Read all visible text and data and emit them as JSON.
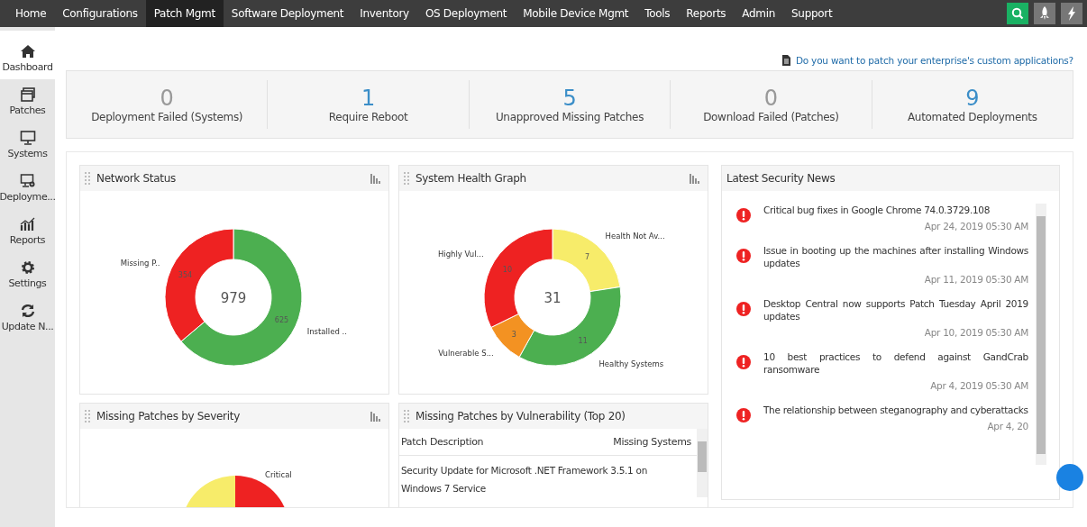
{
  "top_nav": {
    "items": [
      {
        "label": "Home",
        "selected": false
      },
      {
        "label": "Configurations",
        "selected": false
      },
      {
        "label": "Patch Mgmt",
        "selected": true
      },
      {
        "label": "Software Deployment",
        "selected": false
      },
      {
        "label": "Inventory",
        "selected": false
      },
      {
        "label": "OS Deployment",
        "selected": false
      },
      {
        "label": "Mobile Device Mgmt",
        "selected": false
      },
      {
        "label": "Tools",
        "selected": false
      },
      {
        "label": "Reports",
        "selected": false
      },
      {
        "label": "Admin",
        "selected": false
      },
      {
        "label": "Support",
        "selected": false
      }
    ]
  },
  "sidebar": {
    "items": [
      {
        "label": "Dashboard",
        "kind": "home",
        "selected": true
      },
      {
        "label": "Patches",
        "kind": "windows",
        "selected": false
      },
      {
        "label": "Systems",
        "kind": "monitor",
        "selected": false
      },
      {
        "label": "Deployme...",
        "kind": "deploy",
        "selected": false
      },
      {
        "label": "Reports",
        "kind": "chart",
        "selected": false
      },
      {
        "label": "Settings",
        "kind": "gear",
        "selected": false
      },
      {
        "label": "Update N...",
        "kind": "sync",
        "selected": false
      }
    ]
  },
  "custom_apps_link": "Do you want to patch your enterprise's custom applications?",
  "stats": [
    {
      "value": "0",
      "label": "Deployment Failed (Systems)",
      "highlighted": false
    },
    {
      "value": "1",
      "label": "Require Reboot",
      "highlighted": true
    },
    {
      "value": "5",
      "label": "Unapproved Missing Patches",
      "highlighted": true
    },
    {
      "value": "0",
      "label": "Download Failed (Patches)",
      "highlighted": false
    },
    {
      "value": "9",
      "label": "Automated Deployments",
      "highlighted": true
    }
  ],
  "network_status": {
    "title": "Network Status",
    "total": "979",
    "chart_data": {
      "type": "donut",
      "categories": [
        "Installed ..",
        "Missing P.."
      ],
      "values": [
        625,
        354
      ],
      "colors": [
        "#4caf50",
        "#ee2222"
      ],
      "data_labels": true
    }
  },
  "system_health": {
    "title": "System Health Graph",
    "total": "31",
    "chart_data": {
      "type": "donut",
      "categories": [
        "Health Not Av...",
        "Healthy Systems",
        "Vulnerable S...",
        "Highly Vul..."
      ],
      "values": [
        7,
        11,
        3,
        10
      ],
      "colors": [
        "#f7ec6a",
        "#4caf50",
        "#f39222",
        "#ee2222"
      ],
      "data_labels": true
    }
  },
  "severity": {
    "title": "Missing Patches by Severity",
    "visible_label": "Critical"
  },
  "vulnerability": {
    "title": "Missing Patches by Vulnerability (Top 20)",
    "columns": [
      "Patch Description",
      "Missing Systems"
    ],
    "rows": [
      {
        "description": "Security Update for Microsoft .NET Framework 3.5.1 on Windows 7 Service"
      }
    ]
  },
  "security_news": {
    "title": "Latest Security News",
    "items": [
      {
        "title": "Critical bug fixes in Google Chrome 74.0.3729.108",
        "date": "Apr 24, 2019 05:30 AM"
      },
      {
        "title": "Issue in booting up the machines after installing Windows updates",
        "date": "Apr 11, 2019 05:30 AM"
      },
      {
        "title": "Desktop Central now supports Patch Tuesday April 2019 updates",
        "date": "Apr 10, 2019 05:30 AM"
      },
      {
        "title": "10 best practices to defend against GandCrab ransomware",
        "date": "Apr 4, 2019 05:30 AM"
      },
      {
        "title": "The relationship between steganography and cyberattacks",
        "date": "Apr 4, 20"
      }
    ]
  }
}
